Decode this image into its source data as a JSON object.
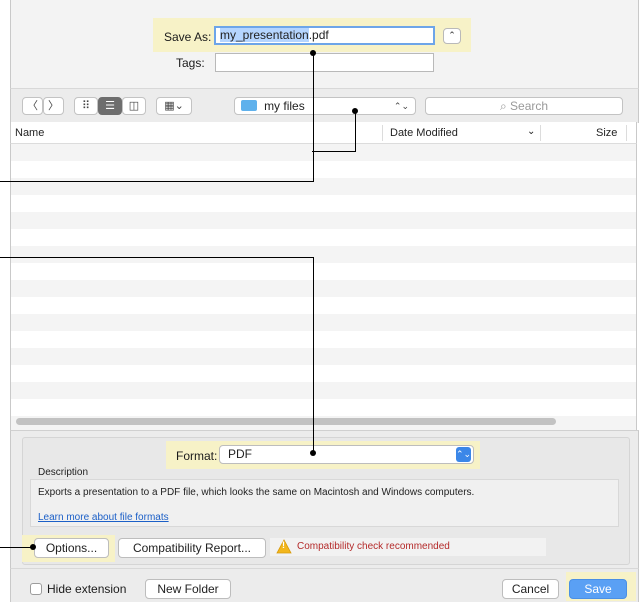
{
  "save_dialog": {
    "save_as_label": "Save As:",
    "filename_selected": "my_presentation",
    "filename_extension": ".pdf",
    "tags_label": "Tags:",
    "tags_value": "",
    "collapse_glyph": "⌃"
  },
  "toolbar": {
    "back_glyph": "〈",
    "forward_glyph": "〉",
    "icon_view_glyph": "⠿",
    "list_view_glyph": "☰",
    "column_view_glyph": "◫",
    "gallery_view_glyph": "▦⌄",
    "location": "my files",
    "location_chevron": "⌃⌄",
    "search_placeholder": "Search",
    "search_glyph": "⌕"
  },
  "file_list": {
    "columns": {
      "name": "Name",
      "date_modified": "Date Modified",
      "size": "Size"
    },
    "sort_glyph": "⌄"
  },
  "options": {
    "format_label": "Format:",
    "format_value": "PDF",
    "format_chevron": "⌃⌄",
    "description_title": "Description",
    "description_text": "Exports a presentation to a PDF file, which looks the same on Macintosh and Windows computers.",
    "learn_more_link": "Learn more about file formats",
    "options_button": "Options...",
    "compat_button": "Compatibility Report...",
    "compat_warning": "Compatibility check recommended",
    "warning_glyph": "!"
  },
  "bottom_bar": {
    "hide_extension_label": "Hide extension",
    "new_folder_button": "New Folder",
    "cancel_button": "Cancel",
    "save_button": "Save"
  },
  "colors": {
    "highlight": "#f7f2c7",
    "accent_blue": "#3b87e8",
    "save_blue": "#5aa0f4",
    "selection": "#b5d5ff",
    "warning_red": "#b42a2a",
    "warning_yellow": "#f2b61c"
  }
}
